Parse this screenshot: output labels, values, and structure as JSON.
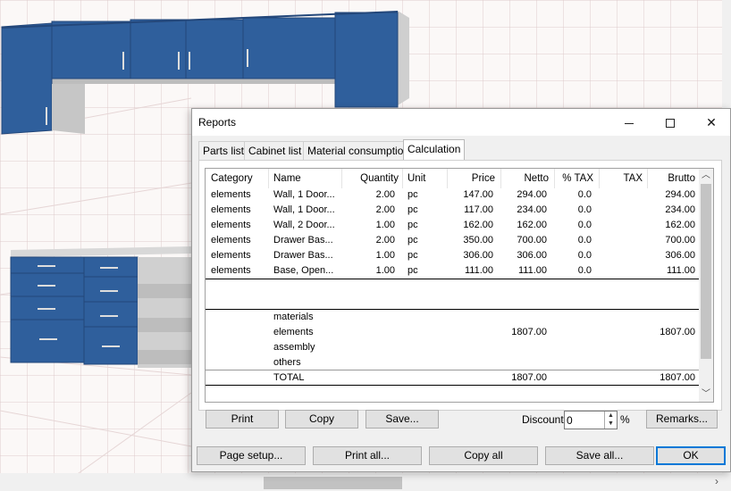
{
  "dialog": {
    "title": "Reports",
    "tabs": [
      {
        "label": "Parts list"
      },
      {
        "label": "Cabinet list"
      },
      {
        "label": "Material consumption"
      },
      {
        "label": "Calculation",
        "active": true
      }
    ]
  },
  "table": {
    "columns": [
      "Category",
      "Name",
      "Quantity",
      "Unit",
      "Price",
      "Netto",
      "% TAX",
      "TAX",
      "Brutto"
    ],
    "rows": [
      {
        "category": "elements",
        "name": "Wall, 1 Door...",
        "quantity": "2.00",
        "unit": "pc",
        "price": "147.00",
        "netto": "294.00",
        "tax_pct": "0.0",
        "tax": "",
        "brutto": "294.00"
      },
      {
        "category": "elements",
        "name": "Wall, 1 Door...",
        "quantity": "2.00",
        "unit": "pc",
        "price": "117.00",
        "netto": "234.00",
        "tax_pct": "0.0",
        "tax": "",
        "brutto": "234.00"
      },
      {
        "category": "elements",
        "name": "Wall, 2 Door...",
        "quantity": "1.00",
        "unit": "pc",
        "price": "162.00",
        "netto": "162.00",
        "tax_pct": "0.0",
        "tax": "",
        "brutto": "162.00"
      },
      {
        "category": "elements",
        "name": "Drawer Bas...",
        "quantity": "2.00",
        "unit": "pc",
        "price": "350.00",
        "netto": "700.00",
        "tax_pct": "0.0",
        "tax": "",
        "brutto": "700.00"
      },
      {
        "category": "elements",
        "name": "Drawer Bas...",
        "quantity": "1.00",
        "unit": "pc",
        "price": "306.00",
        "netto": "306.00",
        "tax_pct": "0.0",
        "tax": "",
        "brutto": "306.00"
      },
      {
        "category": "elements",
        "name": "Base, Open...",
        "quantity": "1.00",
        "unit": "pc",
        "price": "111.00",
        "netto": "111.00",
        "tax_pct": "0.0",
        "tax": "",
        "brutto": "111.00"
      }
    ],
    "summary": [
      {
        "name": "materials",
        "netto": "",
        "brutto": ""
      },
      {
        "name": "elements",
        "netto": "1807.00",
        "brutto": "1807.00"
      },
      {
        "name": "assembly",
        "netto": "",
        "brutto": ""
      },
      {
        "name": "others",
        "netto": "",
        "brutto": ""
      }
    ],
    "total": {
      "name": "TOTAL",
      "netto": "1807.00",
      "brutto": "1807.00"
    }
  },
  "buttons": {
    "print": "Print",
    "copy": "Copy",
    "save": "Save...",
    "remarks": "Remarks...",
    "page_setup": "Page setup...",
    "print_all": "Print all...",
    "copy_all": "Copy all",
    "save_all": "Save all...",
    "ok": "OK"
  },
  "discount": {
    "label": "Discount",
    "value": "0",
    "unit": "%"
  },
  "colors": {
    "cabinet_blue": "#2f5f9c",
    "cabinet_side": "#c9c9c9",
    "accent": "#0078d7"
  }
}
